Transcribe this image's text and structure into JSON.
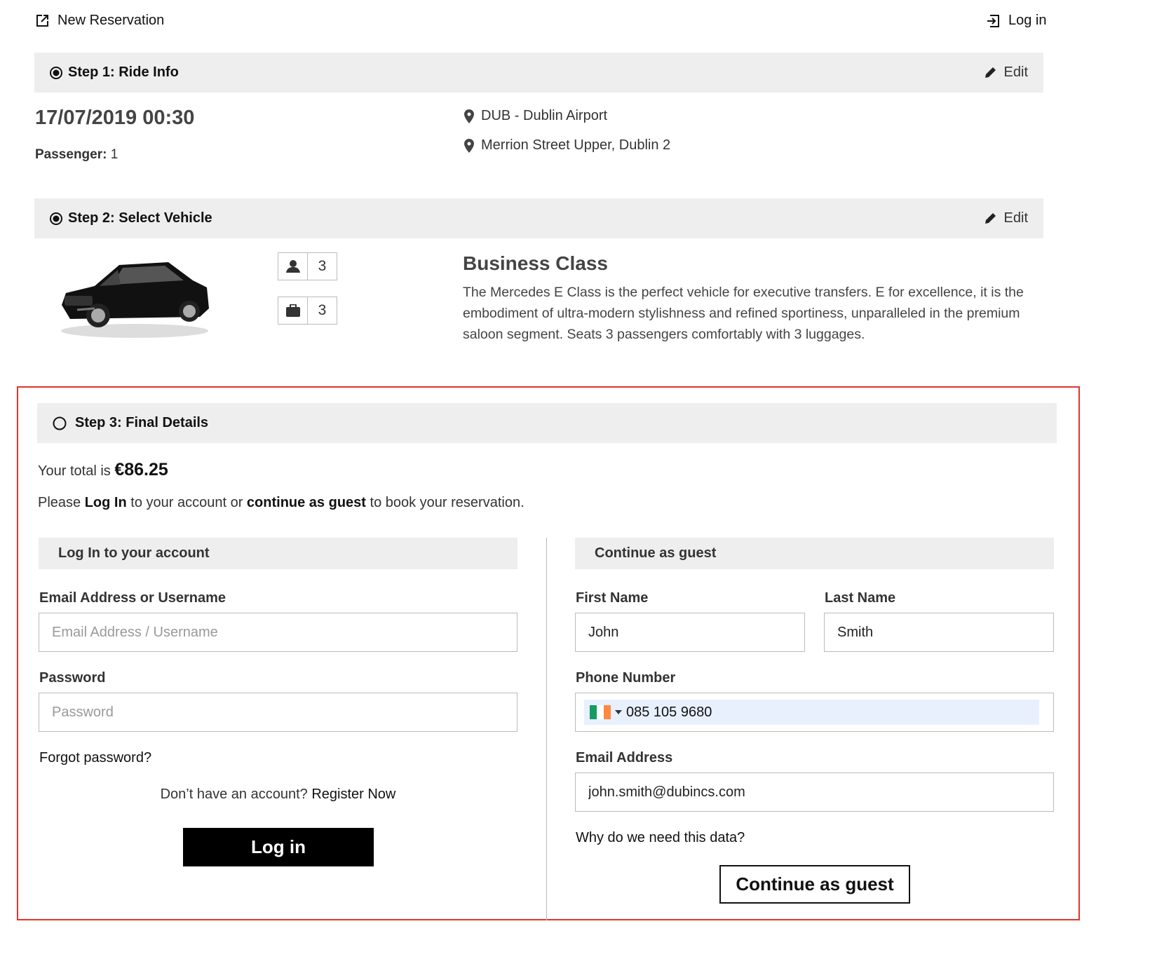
{
  "topbar": {
    "new_reservation": "New Reservation",
    "login": "Log in"
  },
  "step1": {
    "title": "Step 1: Ride Info",
    "edit": "Edit",
    "datetime": "17/07/2019 00:30",
    "passenger_label": "Passenger:",
    "passenger_value": "1",
    "pickup": "DUB - Dublin Airport",
    "dropoff": "Merrion Street Upper, Dublin 2"
  },
  "step2": {
    "title": "Step 2: Select Vehicle",
    "edit": "Edit",
    "passengers": "3",
    "luggage": "3",
    "vehicle_title": "Business Class",
    "vehicle_desc": "The Mercedes E Class is the perfect vehicle for executive transfers. E for excellence, it is the embodiment of ultra-modern stylishness and refined sportiness, unparalleled in the premium saloon segment. Seats 3 passengers comfortably with 3 luggages."
  },
  "step3": {
    "title": "Step 3: Final Details",
    "total_prefix": "Your total is",
    "total_value": "€86.25",
    "info_please": "Please",
    "info_login": "Log In",
    "info_mid": "to your account or",
    "info_guest": "continue as guest",
    "info_end": "to book your reservation."
  },
  "login_panel": {
    "heading": "Log In to your account",
    "email_label": "Email Address or Username",
    "email_placeholder": "Email Address / Username",
    "password_label": "Password",
    "password_placeholder": "Password",
    "forgot": "Forgot password?",
    "no_account": "Don’t have an account?",
    "register": "Register Now",
    "login_button": "Log in"
  },
  "guest_panel": {
    "heading": "Continue as guest",
    "first_name_label": "First Name",
    "first_name_value": "John",
    "last_name_label": "Last Name",
    "last_name_value": "Smith",
    "phone_label": "Phone Number",
    "phone_value": "085 105 9680",
    "email_label": "Email Address",
    "email_value": "john.smith@dubincs.com",
    "why_data": "Why do we need this data?",
    "guest_button": "Continue as guest"
  },
  "colors": {
    "highlight": "#e0352b",
    "flag_green": "#169b62",
    "flag_white": "#ffffff",
    "flag_orange": "#ff883e"
  }
}
